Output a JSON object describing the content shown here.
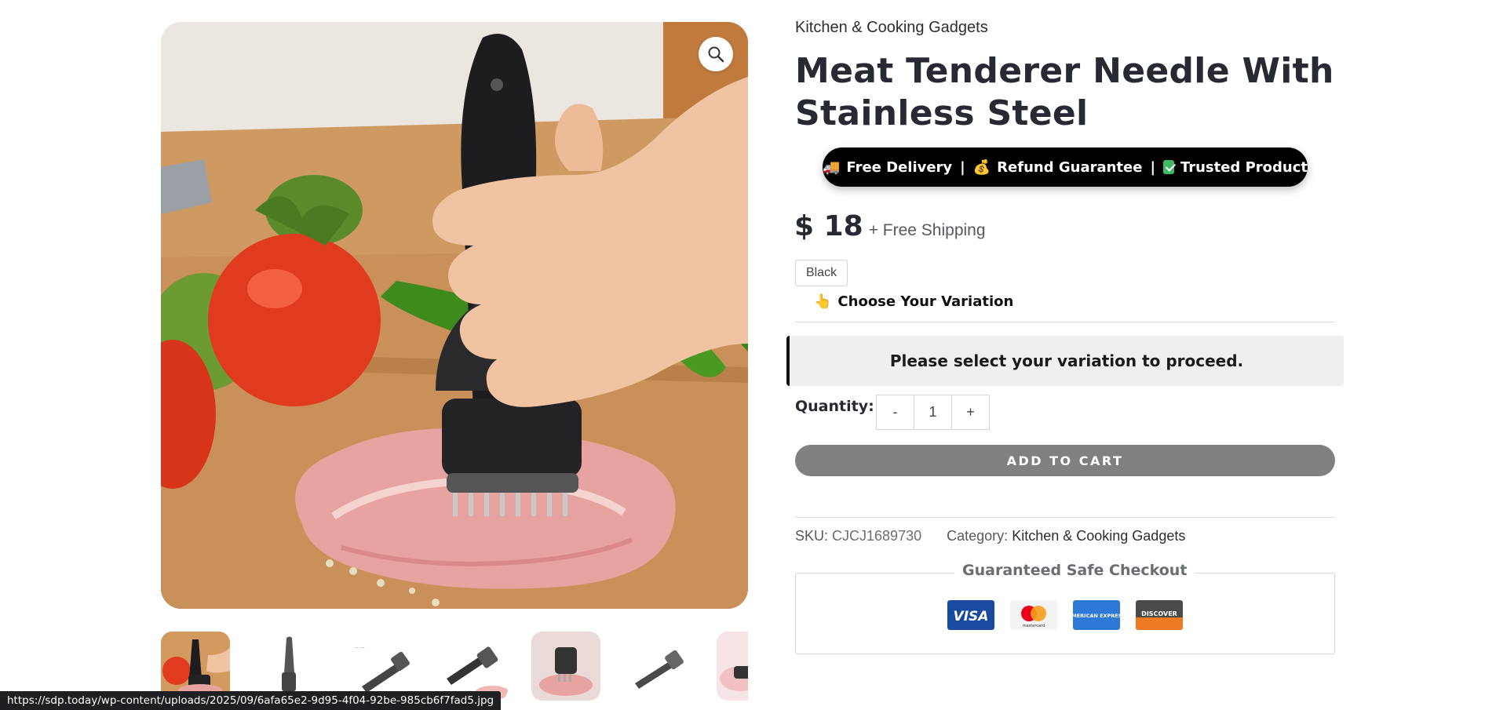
{
  "gallery": {
    "zoom_icon": "search-icon",
    "thumbnail_count": 7
  },
  "product": {
    "category_top": "Kitchen & Cooking Gadgets",
    "title": "Meat Tenderer Needle With Stainless Steel",
    "trust": {
      "delivery_emoji": "🚚",
      "delivery": "Free Delivery",
      "separator": "|",
      "refund_emoji": "💰",
      "refund": "Refund Guarantee",
      "trusted": "Trusted Product"
    },
    "price": "$ 18",
    "shipping": "+ Free Shipping",
    "variation_option": "Black",
    "choose_hand": "👆",
    "choose_label": "Choose Your Variation",
    "notice": "Please select your variation to proceed.",
    "quantity_label": "Quantity:",
    "quantity_minus": "-",
    "quantity_value": "1",
    "quantity_plus": "+",
    "add_to_cart": "ADD TO CART",
    "sku_label": "SKU:",
    "sku_value": "CJCJ1689730",
    "category_label": "Category:",
    "category_value": "Kitchen & Cooking Gadgets",
    "checkout_title": "Guaranteed Safe Checkout",
    "payment_cards": [
      {
        "name": "visa",
        "label": "VISA",
        "color": "#1a4aa0"
      },
      {
        "name": "mastercard",
        "label": "mastercard",
        "color": "#f3f3f3"
      },
      {
        "name": "amex",
        "label": "AMERICAN EXPRESS",
        "color": "#2e78d7"
      },
      {
        "name": "discover",
        "label": "DISCOVER",
        "color": "#4a4a4a"
      }
    ]
  },
  "status_bar": {
    "url": "https://sdp.today/wp-content/uploads/2025/09/6afa65e2-9d95-4f04-92be-985cb6f7fad5.jpg"
  },
  "colors": {
    "title": "#272a33",
    "trust_pill": "#000000",
    "add_to_cart": "#808080",
    "notice_bg": "#efefef"
  }
}
